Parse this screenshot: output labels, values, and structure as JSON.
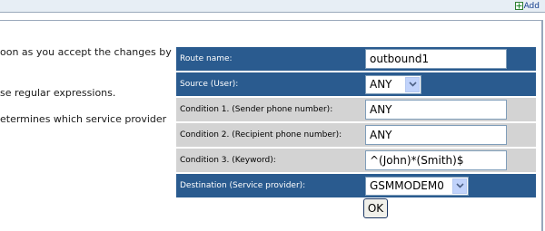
{
  "toolbar": {
    "add_label": "Add",
    "add_icon": "plus-icon"
  },
  "help_text": {
    "line1": "oon as you accept the changes by",
    "line2": "se regular expressions.",
    "line3": "etermines which service provider"
  },
  "form": {
    "route_name": {
      "label": "Route name:",
      "value": "outbound1"
    },
    "source": {
      "label": "Source (User):",
      "selected": "ANY"
    },
    "condition1": {
      "label": "Condition 1. (Sender phone number):",
      "value": "ANY"
    },
    "condition2": {
      "label": "Condition 2. (Recipient phone number):",
      "value": "ANY"
    },
    "condition3": {
      "label": "Condition 3. (Keyword):",
      "value": "^(John)*(Smith)$"
    },
    "destination": {
      "label": "Destination (Service provider):",
      "selected": "GSMMODEM0"
    },
    "ok_label": "OK"
  },
  "colors": {
    "row_blue": "#2a5b8f",
    "row_grey": "#d3d3d3",
    "select_arrow": "#c1d3fb"
  }
}
